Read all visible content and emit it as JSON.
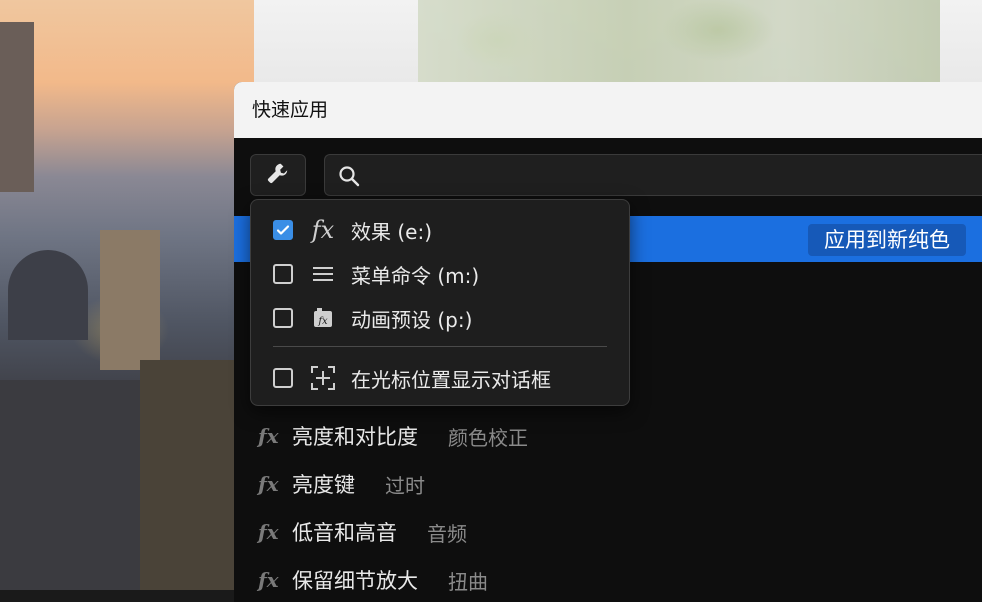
{
  "window": {
    "title": "快速应用"
  },
  "search": {
    "placeholder": "",
    "value": ""
  },
  "highlight": {
    "apply_button_label": "应用到新纯色"
  },
  "filter_menu": {
    "items": [
      {
        "label": "效果 (e:)",
        "checked": true,
        "icon": "fx-icon"
      },
      {
        "label": "菜单命令 (m:)",
        "checked": false,
        "icon": "menu-lines-icon"
      },
      {
        "label": "动画预设 (p:)",
        "checked": false,
        "icon": "animation-preset-icon"
      },
      {
        "label": "在光标位置显示对话框",
        "checked": false,
        "icon": "cursor-position-icon"
      }
    ]
  },
  "results": [
    {
      "icon": "fx-icon",
      "name": "亮度和对比度",
      "category": "颜色校正"
    },
    {
      "icon": "fx-icon",
      "name": "亮度键",
      "category": "过时"
    },
    {
      "icon": "fx-icon",
      "name": "低音和高音",
      "category": "音频"
    },
    {
      "icon": "fx-icon",
      "name": "保留细节放大",
      "category": "扭曲"
    }
  ],
  "colors": {
    "accent": "#1b6fe0",
    "checkbox_checked": "#3a8ee6",
    "window_bg": "#0e0e0e"
  }
}
